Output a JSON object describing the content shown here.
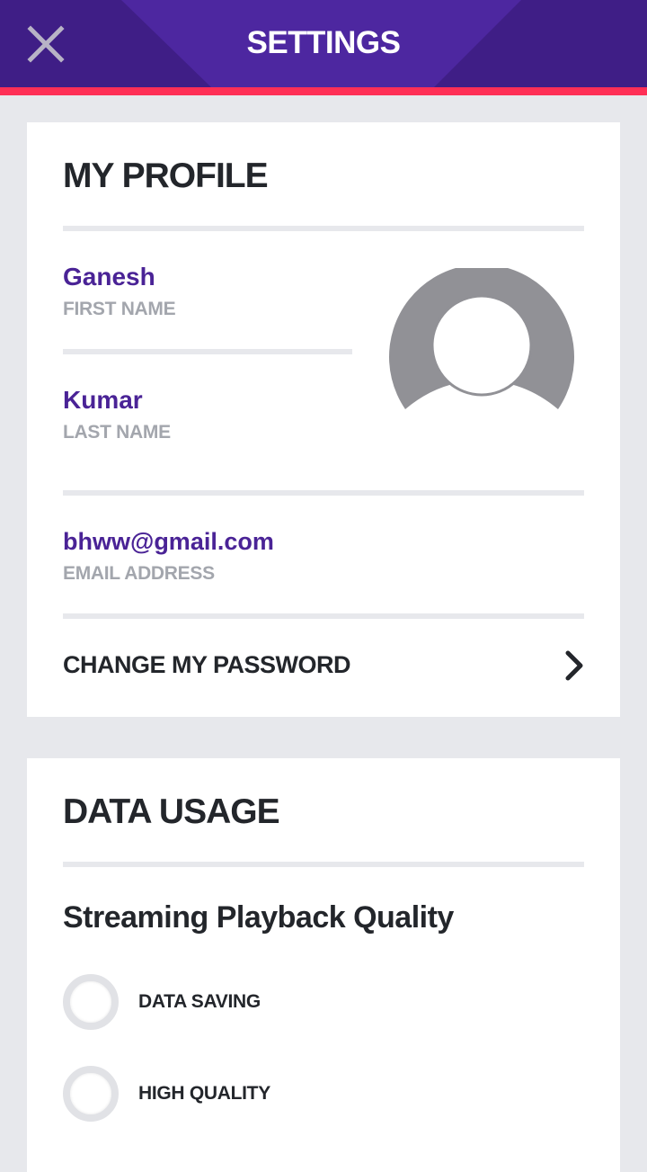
{
  "header": {
    "title": "SETTINGS",
    "close_icon": "close-icon"
  },
  "profile": {
    "section_title": "MY PROFILE",
    "first_name": {
      "value": "Ganesh",
      "label": "FIRST NAME"
    },
    "last_name": {
      "value": "Kumar",
      "label": "LAST NAME"
    },
    "email": {
      "value": "bhww@gmail.com",
      "label": "EMAIL ADDRESS"
    },
    "avatar_icon": "avatar-icon",
    "change_password": {
      "label": "CHANGE MY PASSWORD",
      "icon": "chevron-right-icon"
    }
  },
  "data_usage": {
    "section_title": "DATA USAGE",
    "subtitle": "Streaming Playback Quality",
    "options": [
      {
        "label": "DATA SAVING",
        "selected": false
      },
      {
        "label": "HIGH QUALITY",
        "selected": false
      }
    ]
  },
  "colors": {
    "header_bg": "#4a2396",
    "accent_stripe": "#ff2f56",
    "name_text": "#4a2396",
    "label_text": "#a3a6ad",
    "page_bg": "#e7e8ec"
  }
}
